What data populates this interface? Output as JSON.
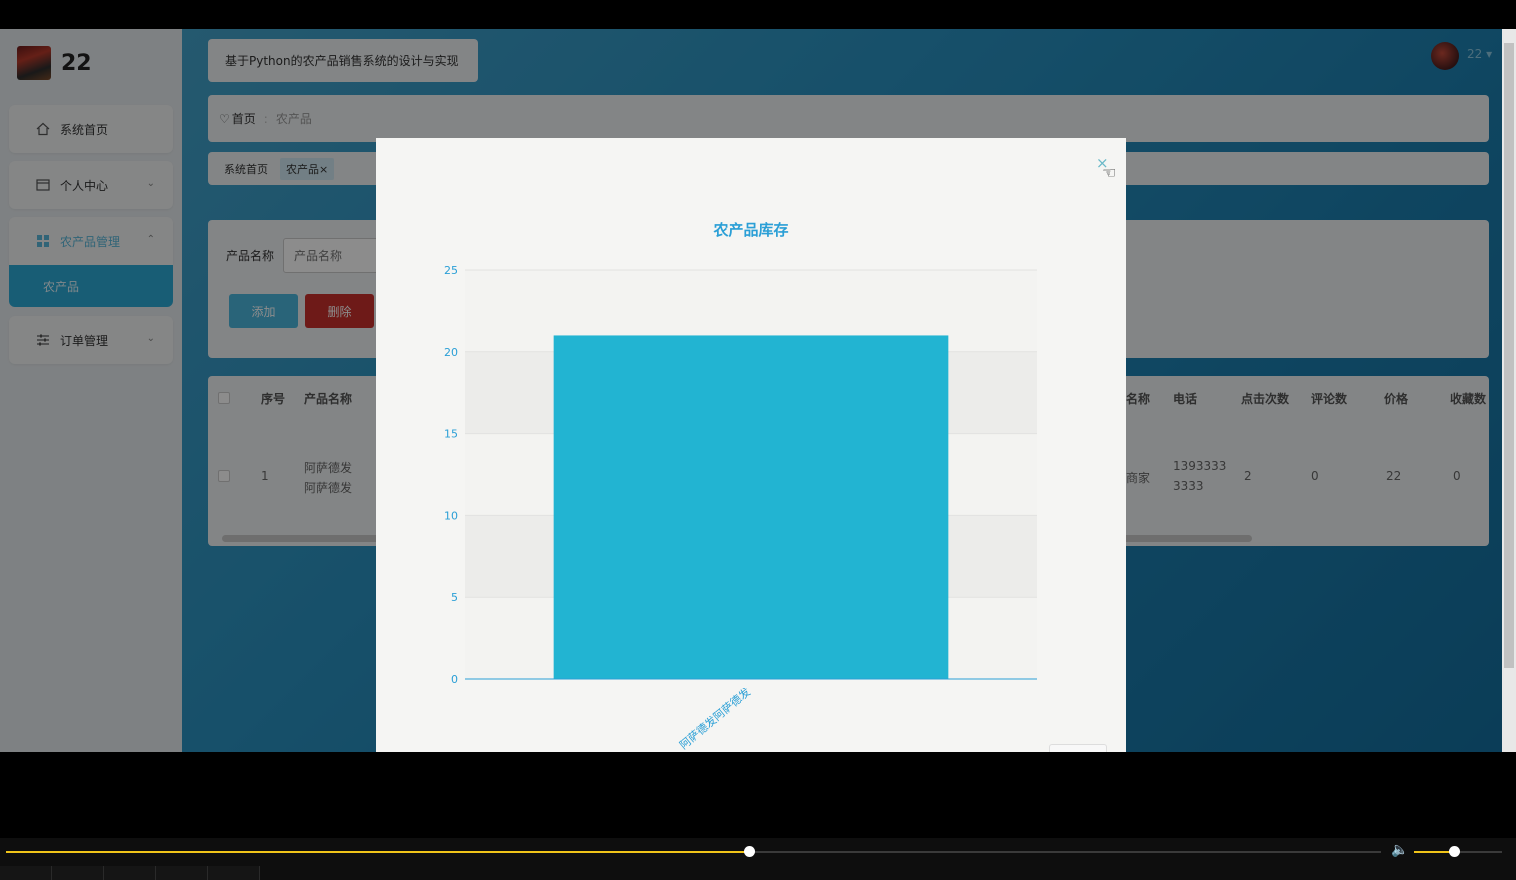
{
  "app": {
    "brand_title": "22",
    "system_title": "基于Python的农产品销售系统的设计与实现",
    "user_name": "22 ▾"
  },
  "sidebar": {
    "items": [
      {
        "label": "系统首页",
        "icon": "home-icon"
      },
      {
        "label": "个人中心",
        "icon": "profile-icon"
      },
      {
        "label": "农产品管理",
        "icon": "grid-icon"
      },
      {
        "label": "订单管理",
        "icon": "sliders-icon"
      }
    ],
    "sub_item": "农产品"
  },
  "breadcrumb": {
    "home": "首页",
    "current": "农产品"
  },
  "tabs": {
    "home": "系统首页",
    "active": "农产品",
    "close": "×"
  },
  "search": {
    "label": "产品名称",
    "placeholder": "产品名称",
    "add_label": "添加",
    "delete_label": "删除"
  },
  "table": {
    "headers": {
      "index": "序号",
      "name": "产品名称",
      "shop": "名称",
      "phone": "电话",
      "clicks": "点击次数",
      "comments": "评论数",
      "price": "价格",
      "favorites": "收藏数"
    },
    "row": {
      "index": "1",
      "name_l1": "阿萨德发",
      "name_l2": "阿萨德发",
      "shop": "商家",
      "phone_l1": "1393333",
      "phone_l2": "3333",
      "clicks": "2",
      "comments": "0",
      "price": "22",
      "favorites": "0"
    }
  },
  "modal": {
    "close": "×"
  },
  "chart_data": {
    "type": "bar",
    "title": "农产品库存",
    "categories": [
      "阿萨德发阿萨德发"
    ],
    "values": [
      21
    ],
    "ylim": [
      0,
      25
    ],
    "yticks": [
      0,
      5,
      10,
      15,
      20,
      25
    ],
    "bar_color": "#22b4d2",
    "axis_color": "#2a9fd6",
    "grid": true
  },
  "player": {
    "progress": 0.54,
    "volume": 0.45,
    "accent": "#f0c419"
  }
}
